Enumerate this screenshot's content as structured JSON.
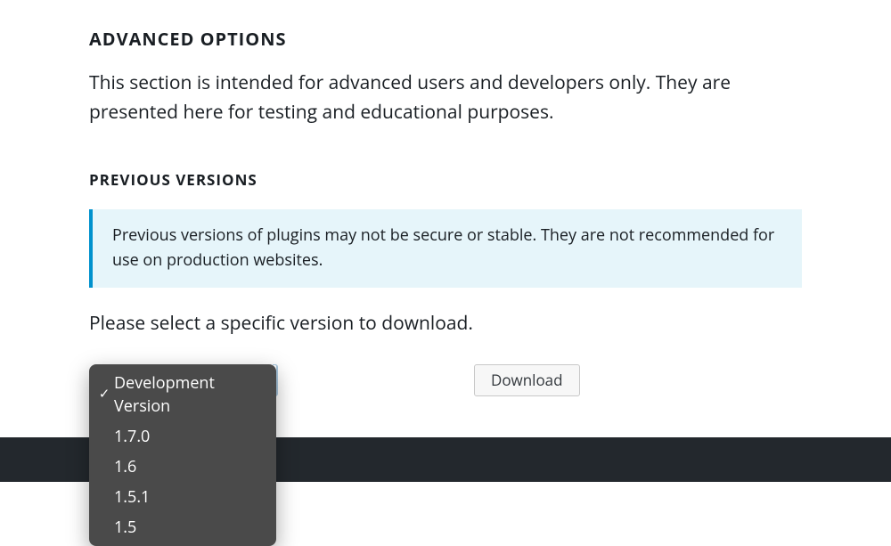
{
  "advanced": {
    "title": "ADVANCED OPTIONS",
    "description": "This section is intended for advanced users and developers only. They are presented here for testing and educational purposes."
  },
  "previous": {
    "title": "PREVIOUS VERSIONS",
    "notice": "Previous versions of plugins may not be secure or stable. They are not recommended for use on production websites.",
    "instruction": "Please select a specific version to download."
  },
  "dropdown": {
    "selected": "Development Version",
    "options": [
      "Development Version",
      "1.7.0",
      "1.6",
      "1.5.1",
      "1.5"
    ]
  },
  "download_label": "Download"
}
